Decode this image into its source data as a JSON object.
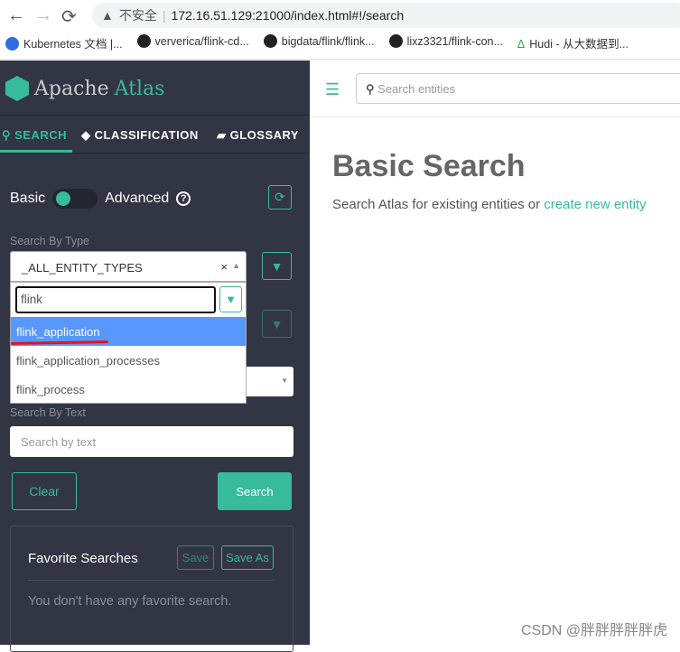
{
  "browser": {
    "back": "←",
    "forward": "→",
    "reload": "⟳",
    "security": "不安全",
    "url": "172.16.51.129:21000/index.html#!/search",
    "bookmarks": [
      "Kubernetes 文档 |...",
      "ververica/flink-cd...",
      "bigdata/flink/flink...",
      "lixz3321/flink-con...",
      "Hudi - 从大数据到..."
    ]
  },
  "sidebar": {
    "logo_a": "Apache",
    "logo_b": "Atlas",
    "tabs": [
      {
        "label": "SEARCH",
        "icon": "search-icon"
      },
      {
        "label": "CLASSIFICATION",
        "icon": "tag-icon"
      },
      {
        "label": "GLOSSARY",
        "icon": "folder-open-icon"
      }
    ],
    "toggle": {
      "basic": "Basic",
      "advanced": "Advanced",
      "help": "?"
    },
    "search_by_type": "Search By Type",
    "type_value": "_ALL_ENTITY_TYPES",
    "clear_x": "×",
    "filter_value": "flink",
    "options": [
      "flink_application",
      "flink_application_processes",
      "flink_process"
    ],
    "search_by_text": "Search By Text",
    "text_placeholder": "Search by text",
    "clear": "Clear",
    "search": "Search",
    "fav": {
      "title": "Favorite Searches",
      "save": "Save",
      "save_as": "Save As",
      "empty": "You don't have any favorite search."
    }
  },
  "main": {
    "search_placeholder": "Search entities",
    "title": "Basic Search",
    "sub": "Search Atlas for existing entities or ",
    "link": "create new entity"
  },
  "watermark": "CSDN @胖胖胖胖胖虎",
  "colors": {
    "accent": "#37bb9b",
    "sidebar": "#323544",
    "highlight": "#5897fb"
  }
}
